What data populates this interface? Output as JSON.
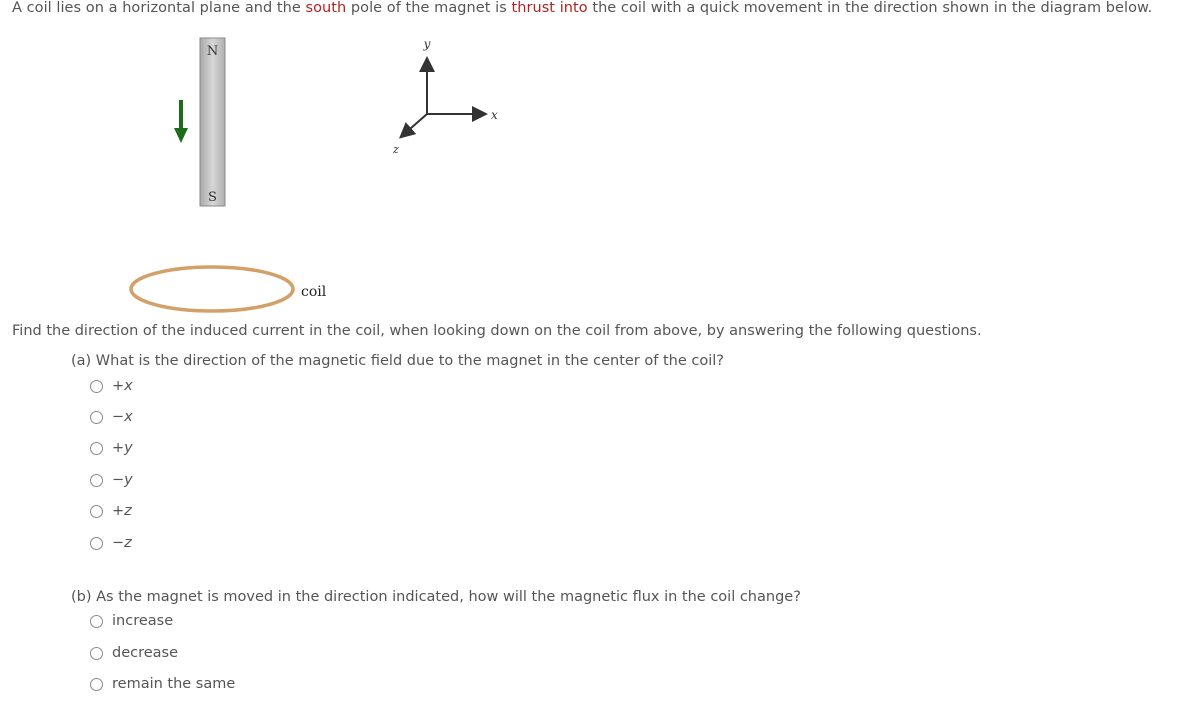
{
  "intro": {
    "part1": "A coil lies on a horizontal plane and the ",
    "highlight1": "south",
    "part2": " pole of the magnet is ",
    "highlight2": "thrust into",
    "part3": " the coil with a quick movement in the direction shown in the diagram below."
  },
  "diagram": {
    "magnet_north_label": "N",
    "magnet_south_label": "S",
    "axis_y_label": "y",
    "axis_x_label": "x",
    "axis_z_label": "z",
    "coil_label": "coil",
    "arrow_color": "#1e6b1e",
    "coil_color": "#d4a06a",
    "magnet_color": "#c8c8c8"
  },
  "prompt": "Find the direction of the induced current in the coil, when looking down on the coil from above, by answering the following questions.",
  "question_a": {
    "text": "(a) What is the direction of the magnetic field due to the magnet in the center of the coil?",
    "options": [
      "+x",
      "−x",
      "+y",
      "−y",
      "+z",
      "−z"
    ]
  },
  "question_b": {
    "text": "(b) As the magnet is moved in the direction indicated, how will the magnetic flux in the coil change?",
    "options": [
      "increase",
      "decrease",
      "remain the same"
    ]
  }
}
